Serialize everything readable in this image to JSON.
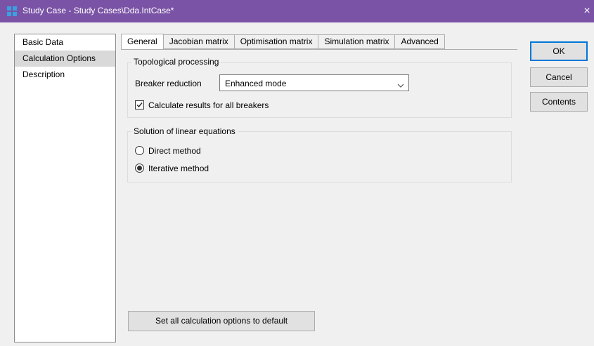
{
  "window": {
    "title": "Study Case - Study Cases\\Dda.IntCase*",
    "close_glyph": "×"
  },
  "sidebar": {
    "items": [
      {
        "label": "Basic Data"
      },
      {
        "label": "Calculation Options",
        "selected": true
      },
      {
        "label": "Description"
      }
    ]
  },
  "tabs": [
    {
      "label": "General",
      "active": true
    },
    {
      "label": "Jacobian matrix"
    },
    {
      "label": "Optimisation matrix"
    },
    {
      "label": "Simulation matrix"
    },
    {
      "label": "Advanced"
    }
  ],
  "topological": {
    "title": "Topological processing",
    "breaker_label": "Breaker reduction",
    "breaker_value": "Enhanced mode",
    "calc_all_label": "Calculate results for all breakers",
    "calc_all_checked": true
  },
  "linear": {
    "title": "Solution of linear equations",
    "direct_label": "Direct method",
    "iterative_label": "Iterative method",
    "selected": "iterative"
  },
  "default_button": "Set all calculation options to default",
  "buttons": {
    "ok": "OK",
    "cancel": "Cancel",
    "contents": "Contents"
  },
  "colors": {
    "titlebar": "#7a53a6",
    "accent": "#0078d7",
    "selected_item": "#d9d9d9"
  }
}
